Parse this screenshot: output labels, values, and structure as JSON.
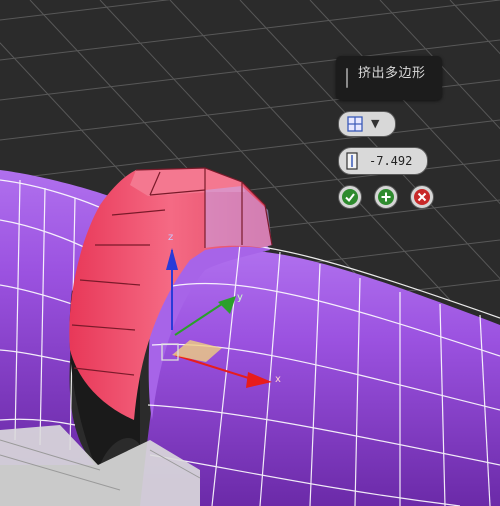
{
  "caddy": {
    "title": "挤出多边形",
    "height_value": "-7.492",
    "mode_icon": "grid-mode-icon",
    "ok_icon": "checkmark-icon",
    "apply_icon": "plus-icon",
    "cancel_icon": "x-icon"
  },
  "gizmo": {
    "x_label": "x",
    "y_label": "y",
    "z_label": "z"
  },
  "colors": {
    "background": "#2b2b2b",
    "grid": "#5a5a5a",
    "cylinder": "#9b52e0",
    "selected_faces": "#f05a78",
    "axis_x": "#e81c1c",
    "axis_y": "#2aa02a",
    "axis_z": "#2a3ad8",
    "ok": "#2e8b2e",
    "cancel": "#c82828"
  }
}
